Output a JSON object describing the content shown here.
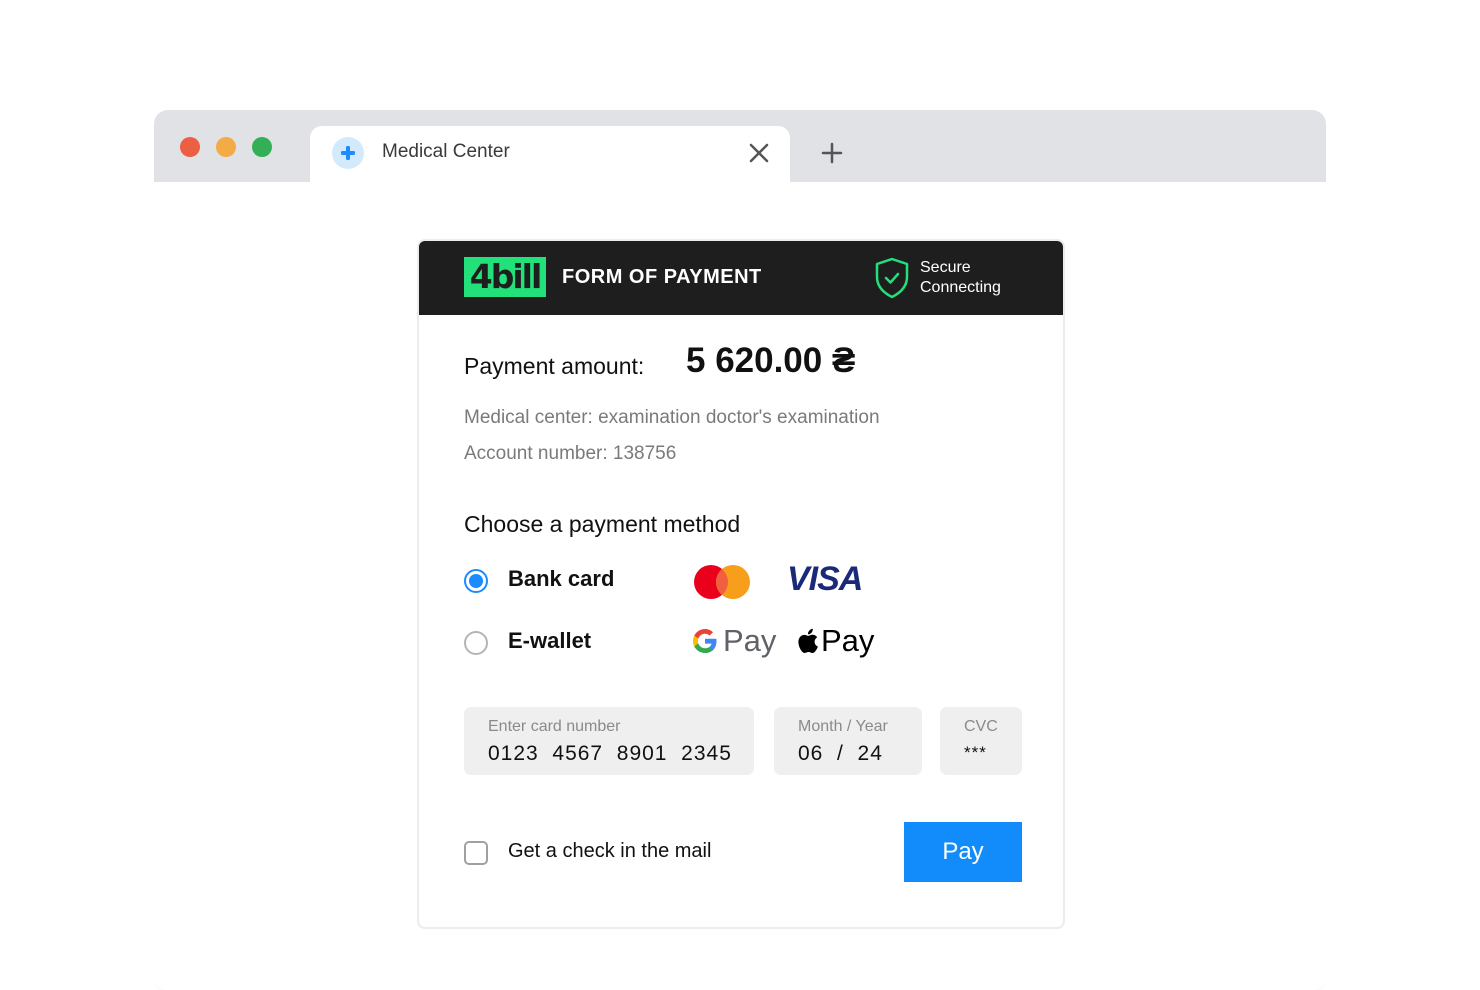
{
  "browser": {
    "window_controls": [
      "close",
      "minimize",
      "maximize"
    ],
    "tab": {
      "title": "Medical Center",
      "favicon": "medical-plus-icon",
      "close_icon": "close-icon"
    },
    "new_tab_icon": "plus-icon"
  },
  "payment_form": {
    "header": {
      "logo_text": "4bill",
      "title": "FORM OF PAYMENT",
      "secure_line1": "Secure",
      "secure_line2": "Connecting",
      "secure_icon": "shield-check-icon"
    },
    "amount_label": "Payment amount:",
    "amount_value": "5 620.00 ₴",
    "description": "Medical center: examination doctor's examination",
    "account": "Account number: 138756",
    "method_title": "Choose a payment method",
    "methods": [
      {
        "label": "Bank card",
        "selected": true,
        "logos": [
          "Mastercard",
          "VISA"
        ]
      },
      {
        "label": "E-wallet",
        "selected": false,
        "logos": [
          "Google Pay",
          "Apple Pay"
        ]
      }
    ],
    "visa_text": "VISA",
    "pay_word": "Pay",
    "fields": {
      "card_number": {
        "placeholder": "Enter card number",
        "value": "0123  4567  8901  2345"
      },
      "expiry": {
        "placeholder": "Month / Year",
        "value": "06  /  24"
      },
      "cvc": {
        "placeholder": "CVC",
        "value": "***"
      }
    },
    "check_mail": {
      "label": "Get a check in the mail",
      "checked": false
    },
    "pay_button": "Pay"
  },
  "colors": {
    "accent_blue": "#128cfb",
    "brand_green": "#22e07a",
    "header_dark": "#1e1e1e",
    "visa_blue": "#1a2a78"
  }
}
